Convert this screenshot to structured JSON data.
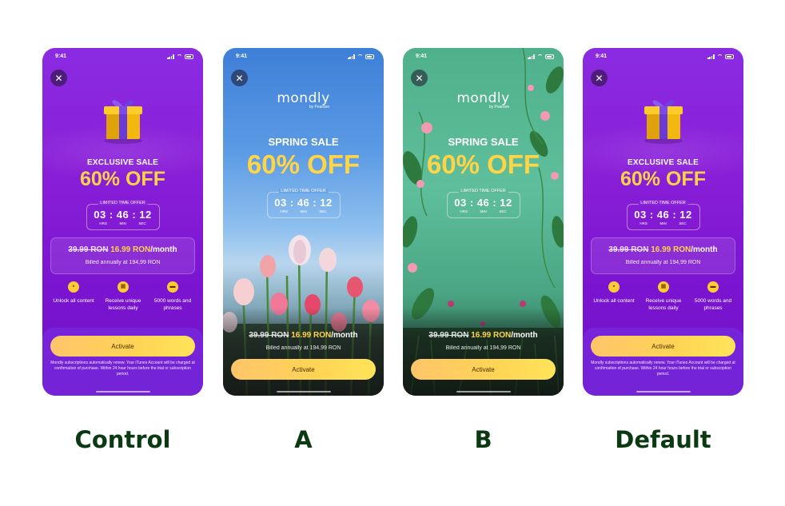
{
  "status_time": "9:41",
  "close_glyph": "✕",
  "timer": {
    "label": "LIMITED TIME OFFER",
    "digits": "03 : 46 : 12",
    "hrs": "HRS",
    "min": "MIN",
    "sec": "SEC"
  },
  "pricing": {
    "old_price": "39.99 RON",
    "new_price": "16.99 RON",
    "per_month": "/month",
    "billed": "Billed annually at 194,99 RON"
  },
  "activate_label": "Activate",
  "legal": "Mondly subscriptions automatically renew. Your iTunes Account will be charged at confirmation of purchase. Within 24 hour hours before the trial or subscription period.",
  "purple_variant": {
    "headline": "EXCLUSIVE SALE",
    "discount": "60% OFF",
    "features": [
      {
        "icon": "lock-icon",
        "label": "Unlock all content"
      },
      {
        "icon": "calendar-icon",
        "label": "Receive unique lessons daily"
      },
      {
        "icon": "chat-icon",
        "label": "5000 words and phrases"
      }
    ]
  },
  "spring_variant": {
    "logo": "mondly",
    "logo_sub": "by Pearson",
    "headline": "SPRING SALE",
    "discount": "60% OFF"
  },
  "captions": {
    "control": "Control",
    "a": "A",
    "b": "B",
    "default": "Default"
  },
  "colors": {
    "purple": "#8a1fd8",
    "accent_yellow": "#ffd447",
    "caption_green": "#0b3a12"
  }
}
